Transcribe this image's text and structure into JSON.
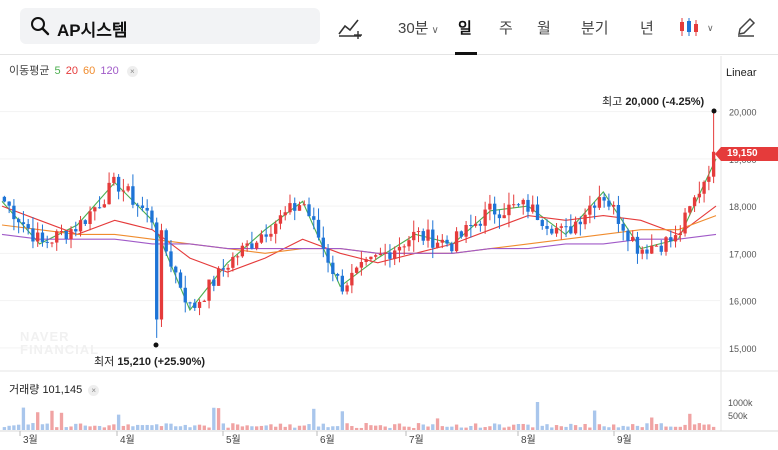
{
  "header": {
    "stock_name": "AP시스템",
    "interval": "30분",
    "tabs": [
      "일",
      "주",
      "월",
      "분기",
      "년"
    ],
    "active_tab": "일"
  },
  "moving_average": {
    "label": "이동평균",
    "periods": [
      {
        "value": "5",
        "color": "#4caf50"
      },
      {
        "value": "20",
        "color": "#e53b3b"
      },
      {
        "value": "60",
        "color": "#f08c2e"
      },
      {
        "value": "120",
        "color": "#a05ac8"
      }
    ]
  },
  "scale_mode": "Linear",
  "price_axis": {
    "ticks": [
      "20,000",
      "19,000",
      "18,000",
      "17,000",
      "16,000",
      "15,000"
    ]
  },
  "current_price_badge": "19,150",
  "high_marker": {
    "label": "최고",
    "value": "20,000 (-4.25%)"
  },
  "low_marker": {
    "label": "최저",
    "value": "15,210 (+25.90%)"
  },
  "watermark": [
    "NAVER",
    "FINANCIAL"
  ],
  "volume": {
    "label": "거래량",
    "value": "101,145",
    "axis_ticks": [
      "1000k",
      "500k"
    ]
  },
  "time_axis": {
    "months": [
      "3월",
      "4월",
      "5월",
      "6월",
      "7월",
      "8월",
      "9월"
    ]
  },
  "colors": {
    "up": "#e53b3b",
    "down": "#1e74d6",
    "volume_up": "#f0a3a3",
    "volume_down": "#a9c6ec"
  },
  "chart_data": {
    "type": "candlestick",
    "y_range": [
      14700,
      20500
    ],
    "high": 20000,
    "low": 15210,
    "last": 19150,
    "price_ticks": [
      20000,
      19000,
      18000,
      17000,
      16000,
      15000
    ],
    "months": [
      "3월",
      "4월",
      "5월",
      "6월",
      "7월",
      "8월",
      "9월"
    ],
    "series": [
      {
        "name": "5",
        "approx_values": [
          18100,
          17200,
          17600,
          18500,
          17700,
          15800,
          16800,
          17500,
          18100,
          16300,
          16900,
          17400,
          17200,
          17900,
          18000,
          17400,
          18300,
          17100,
          17300,
          19000
        ]
      },
      {
        "name": "20",
        "approx_values": [
          18000,
          17700,
          17400,
          17700,
          17500,
          16900,
          16600,
          16900,
          17300,
          17000,
          16800,
          17000,
          17200,
          17500,
          17800,
          17700,
          17800,
          17700,
          17400,
          18000
        ]
      },
      {
        "name": "60",
        "approx_values": [
          17600,
          17500,
          17400,
          17400,
          17300,
          17200,
          17100,
          17000,
          17100,
          17100,
          17000,
          17000,
          17000,
          17100,
          17200,
          17300,
          17400,
          17500,
          17500,
          17800
        ]
      },
      {
        "name": "120",
        "approx_values": [
          17400,
          17300,
          17300,
          17300,
          17200,
          17200,
          17100,
          17100,
          17100,
          17100,
          17000,
          17000,
          17000,
          17100,
          17100,
          17200,
          17200,
          17300,
          17300,
          17400
        ]
      }
    ]
  }
}
